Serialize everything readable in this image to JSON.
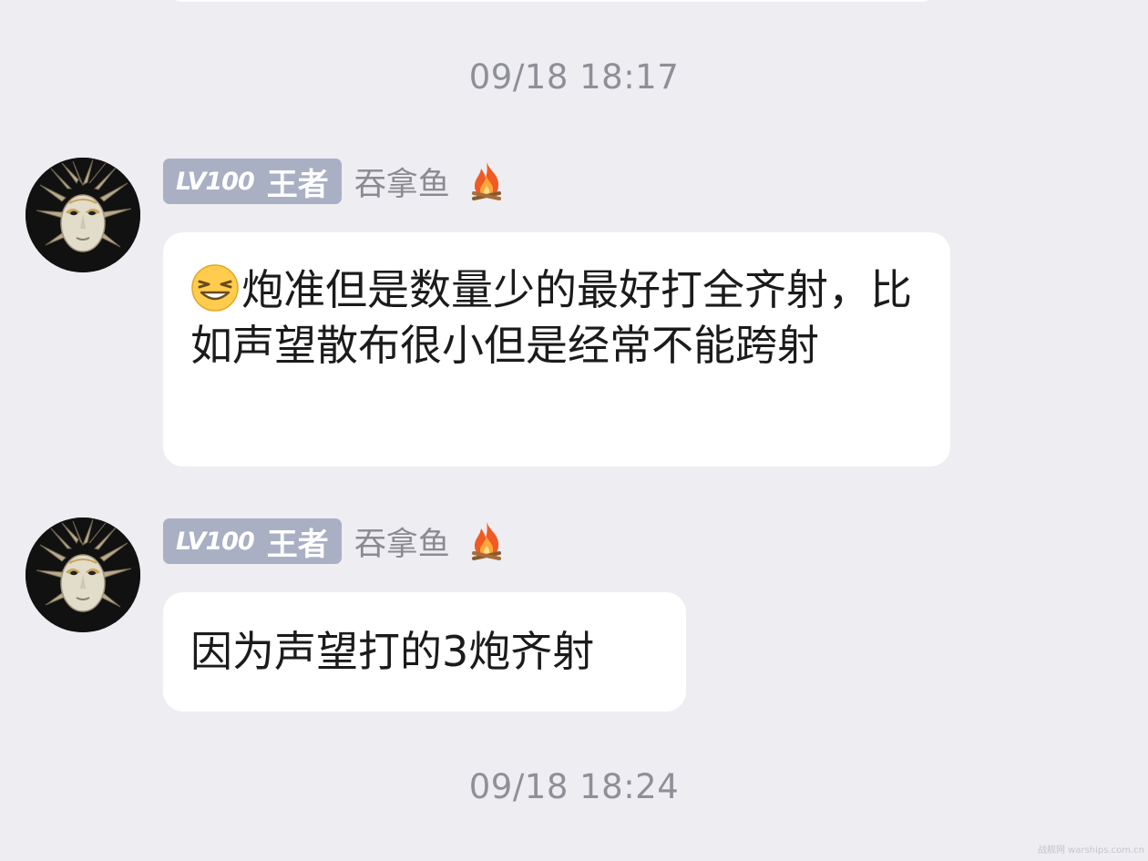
{
  "chat": {
    "timestamps": [
      "09/18 18:17",
      "09/18 18:24"
    ],
    "messages": [
      {
        "sender": {
          "level": "LV100",
          "rank": "王者",
          "name": "吞拿鱼",
          "badge_icon": "flame-icon",
          "avatar_icon": "venetian-mask-avatar"
        },
        "emoji": "smirk-grin-emoji",
        "text": "炮准但是数量少的最好打全齐射，比如声望散布很小但是经常不能跨射"
      },
      {
        "sender": {
          "level": "LV100",
          "rank": "王者",
          "name": "吞拿鱼",
          "badge_icon": "flame-icon",
          "avatar_icon": "venetian-mask-avatar"
        },
        "text": "因为声望打的3炮齐射"
      }
    ]
  },
  "watermark": "战舰网 warships.com.cn",
  "colors": {
    "background": "#ededf2",
    "bubble": "#ffffff",
    "badge": "#a9b0c4",
    "timestamp": "#8f8f98",
    "username": "#8a8a92"
  }
}
